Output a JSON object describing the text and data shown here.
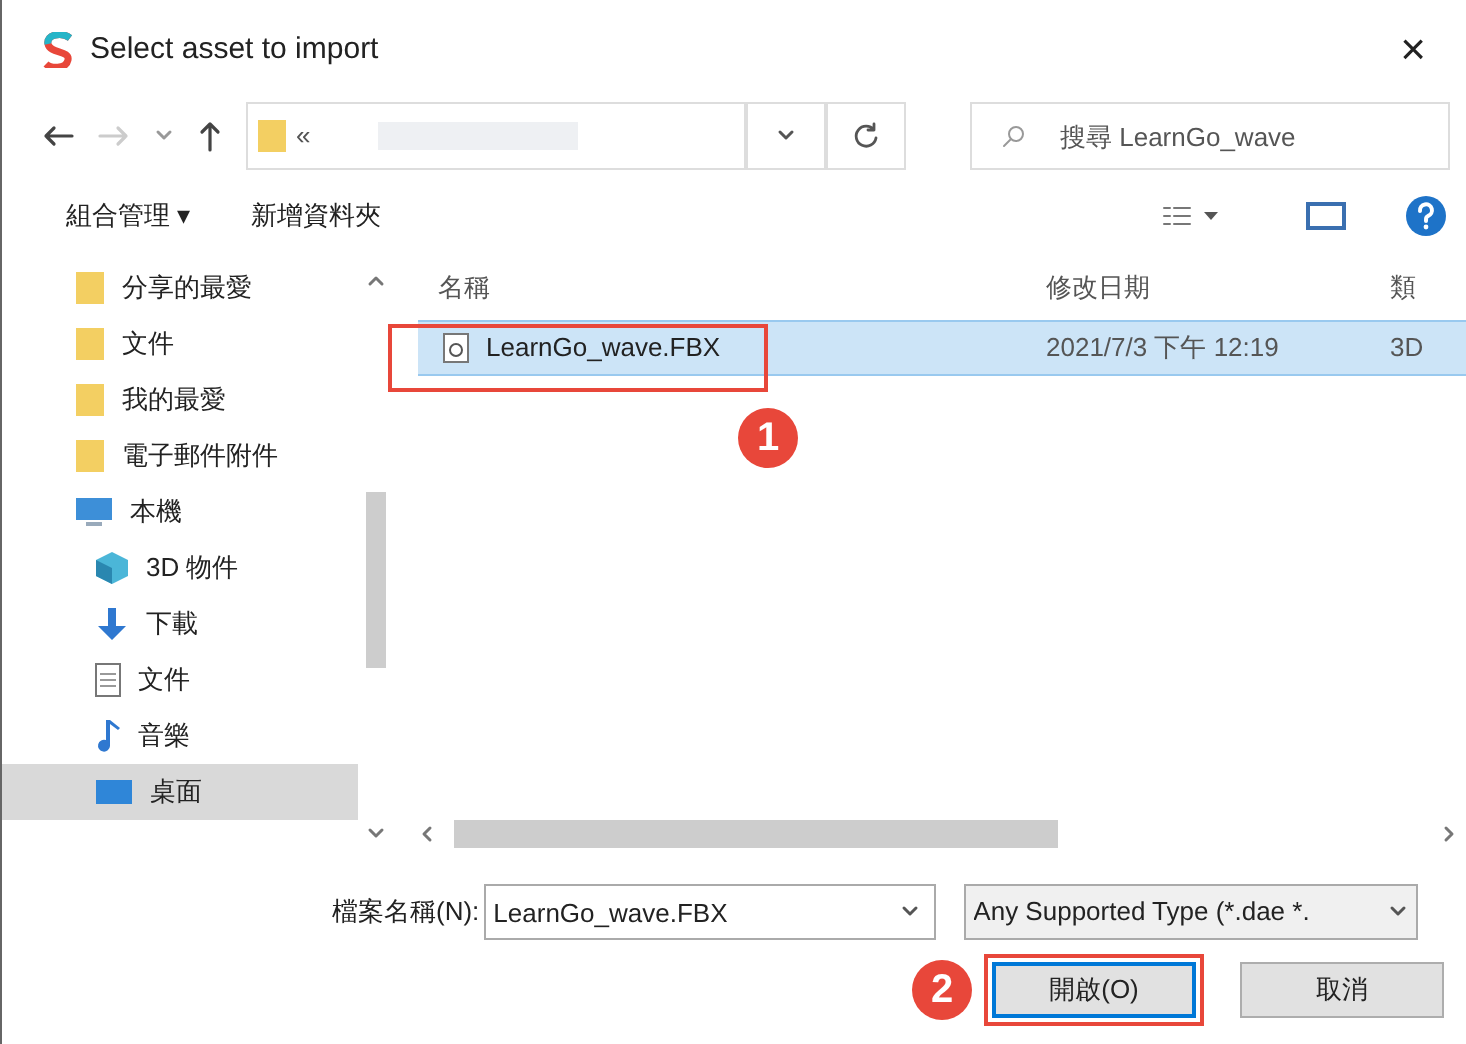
{
  "window": {
    "title": "Select asset to import",
    "close": "×"
  },
  "address": {
    "prefix": "«"
  },
  "search": {
    "placeholder": "搜尋 LearnGo_wave"
  },
  "toolbar": {
    "organize": "組合管理 ▾",
    "new_folder": "新增資料夾"
  },
  "sidebar": {
    "items": [
      {
        "label": "分享的最愛",
        "kind": "folder",
        "selected": false
      },
      {
        "label": "文件",
        "kind": "folder",
        "selected": false
      },
      {
        "label": "我的最愛",
        "kind": "folder",
        "selected": false
      },
      {
        "label": "電子郵件附件",
        "kind": "folder",
        "selected": false
      },
      {
        "label": "本機",
        "kind": "pc",
        "selected": false,
        "children": [
          {
            "label": "3D 物件",
            "kind": "cube",
            "selected": false
          },
          {
            "label": "下載",
            "kind": "download",
            "selected": false
          },
          {
            "label": "文件",
            "kind": "doc",
            "selected": false
          },
          {
            "label": "音樂",
            "kind": "music",
            "selected": false
          },
          {
            "label": "桌面",
            "kind": "desktop",
            "selected": true
          }
        ]
      }
    ]
  },
  "table": {
    "columns": [
      "名稱",
      "修改日期",
      "類"
    ],
    "rows": [
      {
        "name": "LearnGo_wave.FBX",
        "date": "2021/7/3 下午 12:19",
        "type": "3D",
        "selected": true
      }
    ]
  },
  "filename": {
    "label": "檔案名稱(N):",
    "value": "LearnGo_wave.FBX"
  },
  "filetype": {
    "value": "Any Supported Type (*.dae *."
  },
  "buttons": [
    {
      "label": "開啟(O)",
      "selected": true
    },
    {
      "label": "取消",
      "selected": false
    }
  ],
  "annotations": [
    "1",
    "2"
  ]
}
